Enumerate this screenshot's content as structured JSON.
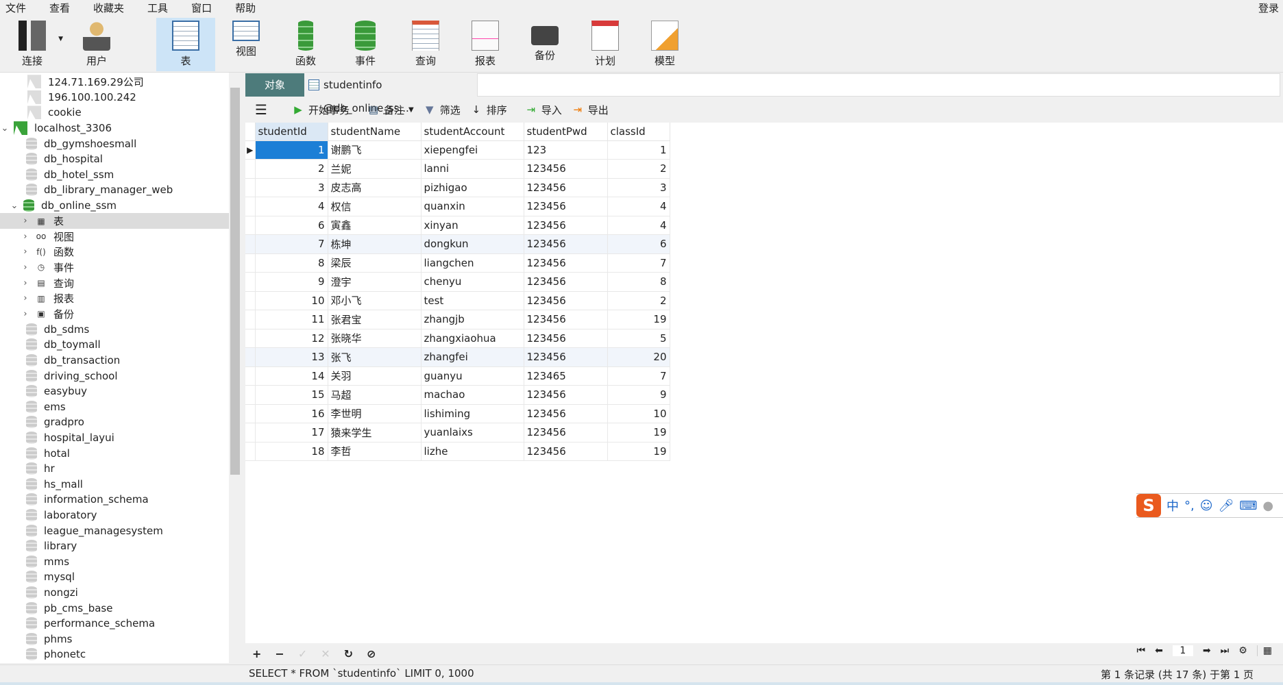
{
  "menu": [
    "文件",
    "查看",
    "收藏夹",
    "工具",
    "窗口",
    "帮助"
  ],
  "login": "登录",
  "toolbar": [
    {
      "label": "连接",
      "icon": "connection-icon"
    },
    {
      "label": "用户",
      "icon": "user-icon"
    },
    {
      "label": "表",
      "icon": "table-icon"
    },
    {
      "label": "视图",
      "icon": "view-icon"
    },
    {
      "label": "函数",
      "icon": "function-icon"
    },
    {
      "label": "事件",
      "icon": "event-icon"
    },
    {
      "label": "查询",
      "icon": "query-icon"
    },
    {
      "label": "报表",
      "icon": "report-icon"
    },
    {
      "label": "备份",
      "icon": "backup-icon"
    },
    {
      "label": "计划",
      "icon": "schedule-icon"
    },
    {
      "label": "模型",
      "icon": "model-icon"
    }
  ],
  "tree": {
    "connections": [
      "124.71.169.29公司",
      "196.100.100.242",
      "cookie",
      "localhost_3306"
    ],
    "dbs_before": [
      "db_gymshoesmall",
      "db_hospital",
      "db_hotel_ssm",
      "db_library_manager_web"
    ],
    "open_db": "db_online_ssm",
    "children": [
      "表",
      "视图",
      "函数",
      "事件",
      "查询",
      "报表",
      "备份"
    ],
    "dbs_after": [
      "db_sdms",
      "db_toymall",
      "db_transaction",
      "driving_school",
      "easybuy",
      "ems",
      "gradpro",
      "hospital_layui",
      "hotal",
      "hr",
      "hs_mall",
      "information_schema",
      "laboratory",
      "league_managesystem",
      "library",
      "mms",
      "mysql",
      "nongzi",
      "pb_cms_base",
      "performance_schema",
      "phms",
      "phonetc"
    ]
  },
  "tabs": {
    "objects": "对象",
    "table_tab": "studentinfo @db_online_ss..."
  },
  "subtoolbar": {
    "begin_tx": "开始事务",
    "note": "备注",
    "filter": "筛选",
    "sort": "排序",
    "import": "导入",
    "export": "导出"
  },
  "grid": {
    "columns": [
      "studentId",
      "studentName",
      "studentAccount",
      "studentPwd",
      "classId"
    ],
    "rows": [
      [
        "1",
        "谢鹏飞",
        "xiepengfei",
        "123",
        "1"
      ],
      [
        "2",
        "兰妮",
        "lanni",
        "123456",
        "2"
      ],
      [
        "3",
        "皮志高",
        "pizhigao",
        "123456",
        "3"
      ],
      [
        "4",
        "权信",
        "quanxin",
        "123456",
        "4"
      ],
      [
        "6",
        "寅鑫",
        "xinyan",
        "123456",
        "4"
      ],
      [
        "7",
        "栋坤",
        "dongkun",
        "123456",
        "6"
      ],
      [
        "8",
        "梁辰",
        "liangchen",
        "123456",
        "7"
      ],
      [
        "9",
        "澄宇",
        "chenyu",
        "123456",
        "8"
      ],
      [
        "10",
        "邓小飞",
        "test",
        "123456",
        "2"
      ],
      [
        "11",
        "张君宝",
        "zhangjb",
        "123456",
        "19"
      ],
      [
        "12",
        "张晓华",
        "zhangxiaohua",
        "123456",
        "5"
      ],
      [
        "13",
        "张飞",
        "zhangfei",
        "123456",
        "20"
      ],
      [
        "14",
        "关羽",
        "guanyu",
        "123465",
        "7"
      ],
      [
        "15",
        "马超",
        "machao",
        "123456",
        "9"
      ],
      [
        "16",
        "李世明",
        "lishiming",
        "123456",
        "10"
      ],
      [
        "17",
        "猿来学生",
        "yuanlaixs",
        "123456",
        "19"
      ],
      [
        "18",
        "李哲",
        "lizhe",
        "123456",
        "19"
      ]
    ]
  },
  "pager": {
    "page": "1"
  },
  "status": {
    "sql": "SELECT * FROM `studentinfo` LIMIT 0, 1000",
    "records": "第 1 条记录 (共 17 条) 于第 1 页"
  },
  "ime": {
    "logo": "S",
    "mode": "中",
    "punct": "°,"
  }
}
